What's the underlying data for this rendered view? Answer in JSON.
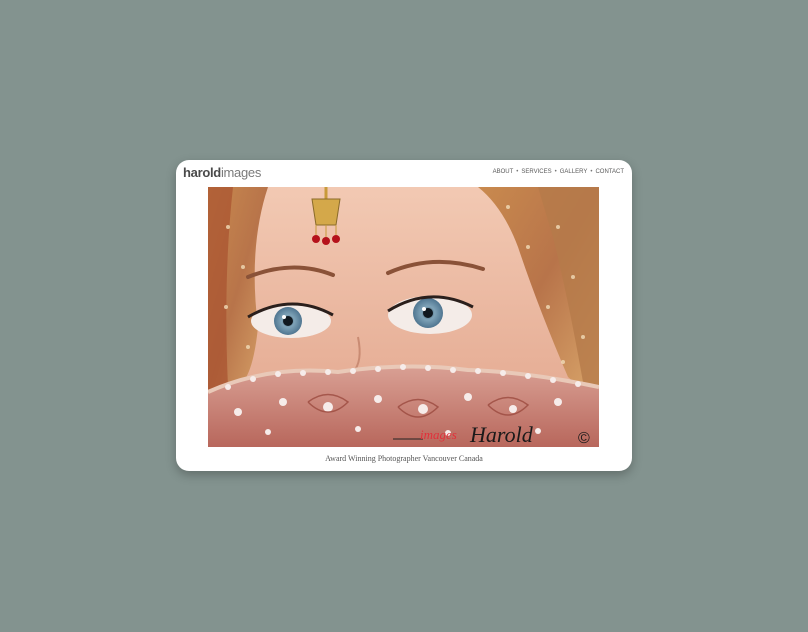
{
  "logo": {
    "bold": "harold",
    "light": "images"
  },
  "nav": {
    "items": [
      "ABOUT",
      "SERVICES",
      "GALLERY",
      "CONTACT"
    ],
    "separator": "•"
  },
  "photo": {
    "watermark_red": "images",
    "watermark_black": "Harold",
    "watermark_mark": "©"
  },
  "caption": "Award Winning Photographer Vancouver Canada"
}
